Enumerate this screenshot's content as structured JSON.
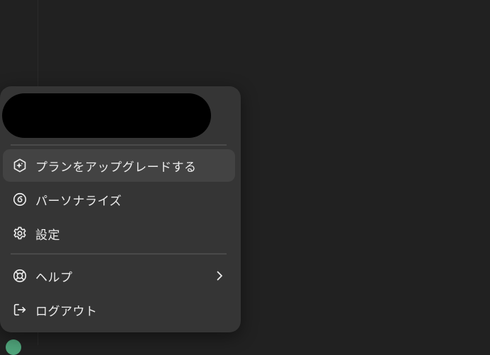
{
  "menu": {
    "items": [
      {
        "label": "プランをアップグレードする",
        "icon": "upgrade-sparkle-icon"
      },
      {
        "label": "パーソナライズ",
        "icon": "personalize-icon"
      },
      {
        "label": "設定",
        "icon": "gear-icon"
      },
      {
        "label": "ヘルプ",
        "icon": "lifebuoy-icon",
        "submenu_icon": "chevron-right-icon"
      },
      {
        "label": "ログアウト",
        "icon": "logout-icon"
      }
    ]
  },
  "colors": {
    "page_background": "#212121",
    "menu_background": "#353535",
    "hover_background": "#434343",
    "text": "#ececec",
    "divider": "#4a4a4a",
    "redaction": "#000000",
    "avatar": "#4fa37a"
  }
}
